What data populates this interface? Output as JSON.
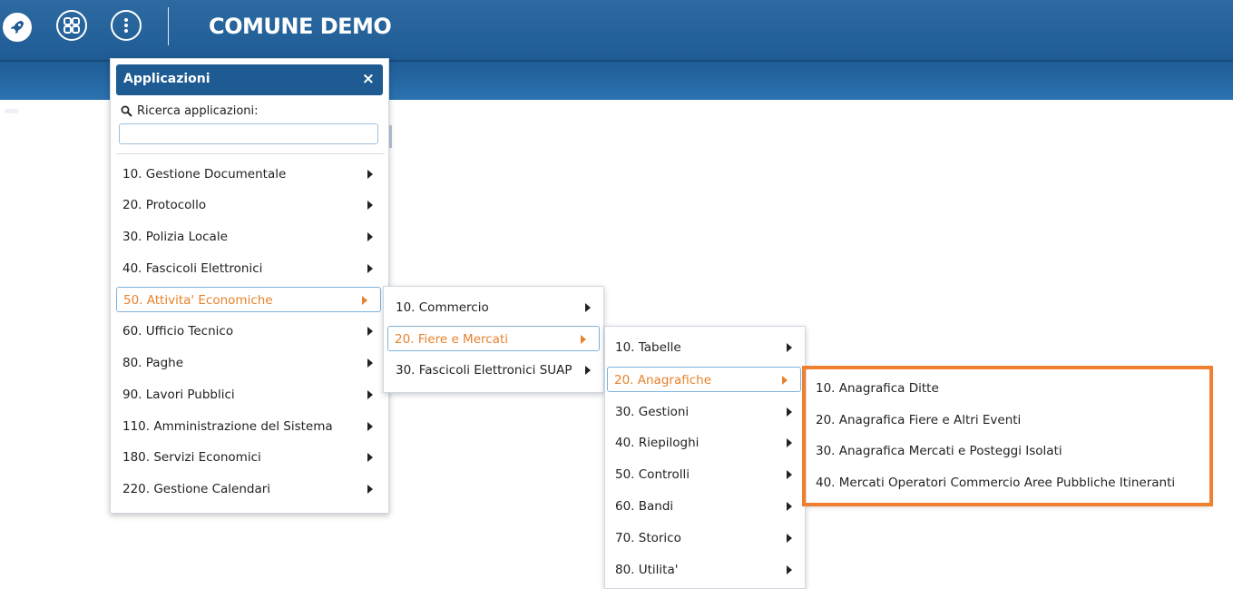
{
  "topbar": {
    "title": "COMUNE DEMO",
    "icons": [
      "rocket-icon",
      "apps-grid-icon",
      "more-vertical-icon"
    ]
  },
  "apps_panel": {
    "title": "Applicazioni",
    "close_label": "×",
    "search_label": "Ricerca applicazioni:",
    "search_value": "",
    "items": [
      {
        "label": "10. Gestione Documentale"
      },
      {
        "label": "20. Protocollo"
      },
      {
        "label": "30. Polizia Locale"
      },
      {
        "label": "40. Fascicoli Elettronici"
      },
      {
        "label": "50. Attivita' Economiche",
        "active": true
      },
      {
        "label": "60. Ufficio Tecnico"
      },
      {
        "label": "80. Paghe"
      },
      {
        "label": "90. Lavori Pubblici"
      },
      {
        "label": "110. Amministrazione del Sistema"
      },
      {
        "label": "180. Servizi Economici"
      },
      {
        "label": "220. Gestione Calendari"
      }
    ]
  },
  "submenu_attivita": {
    "items": [
      {
        "label": "10. Commercio"
      },
      {
        "label": "20. Fiere e Mercati",
        "active": true
      },
      {
        "label": "30. Fascicoli Elettronici SUAP"
      }
    ]
  },
  "submenu_fiere": {
    "items": [
      {
        "label": "10. Tabelle"
      },
      {
        "label": "20. Anagrafiche",
        "active": true
      },
      {
        "label": "30. Gestioni"
      },
      {
        "label": "40. Riepiloghi"
      },
      {
        "label": "50. Controlli"
      },
      {
        "label": "60. Bandi"
      },
      {
        "label": "70. Storico"
      },
      {
        "label": "80. Utilita'"
      }
    ]
  },
  "submenu_anagrafiche": {
    "items": [
      {
        "label": "10. Anagrafica Ditte"
      },
      {
        "label": "20. Anagrafica Fiere e Altri Eventi"
      },
      {
        "label": "30. Anagrafica Mercati e Posteggi Isolati"
      },
      {
        "label": "40. Mercati Operatori Commercio Aree Pubbliche Itineranti"
      }
    ]
  },
  "colors": {
    "topbar": "#1f5c95",
    "active_text": "#e8822b",
    "highlight_border": "#f0802f"
  }
}
